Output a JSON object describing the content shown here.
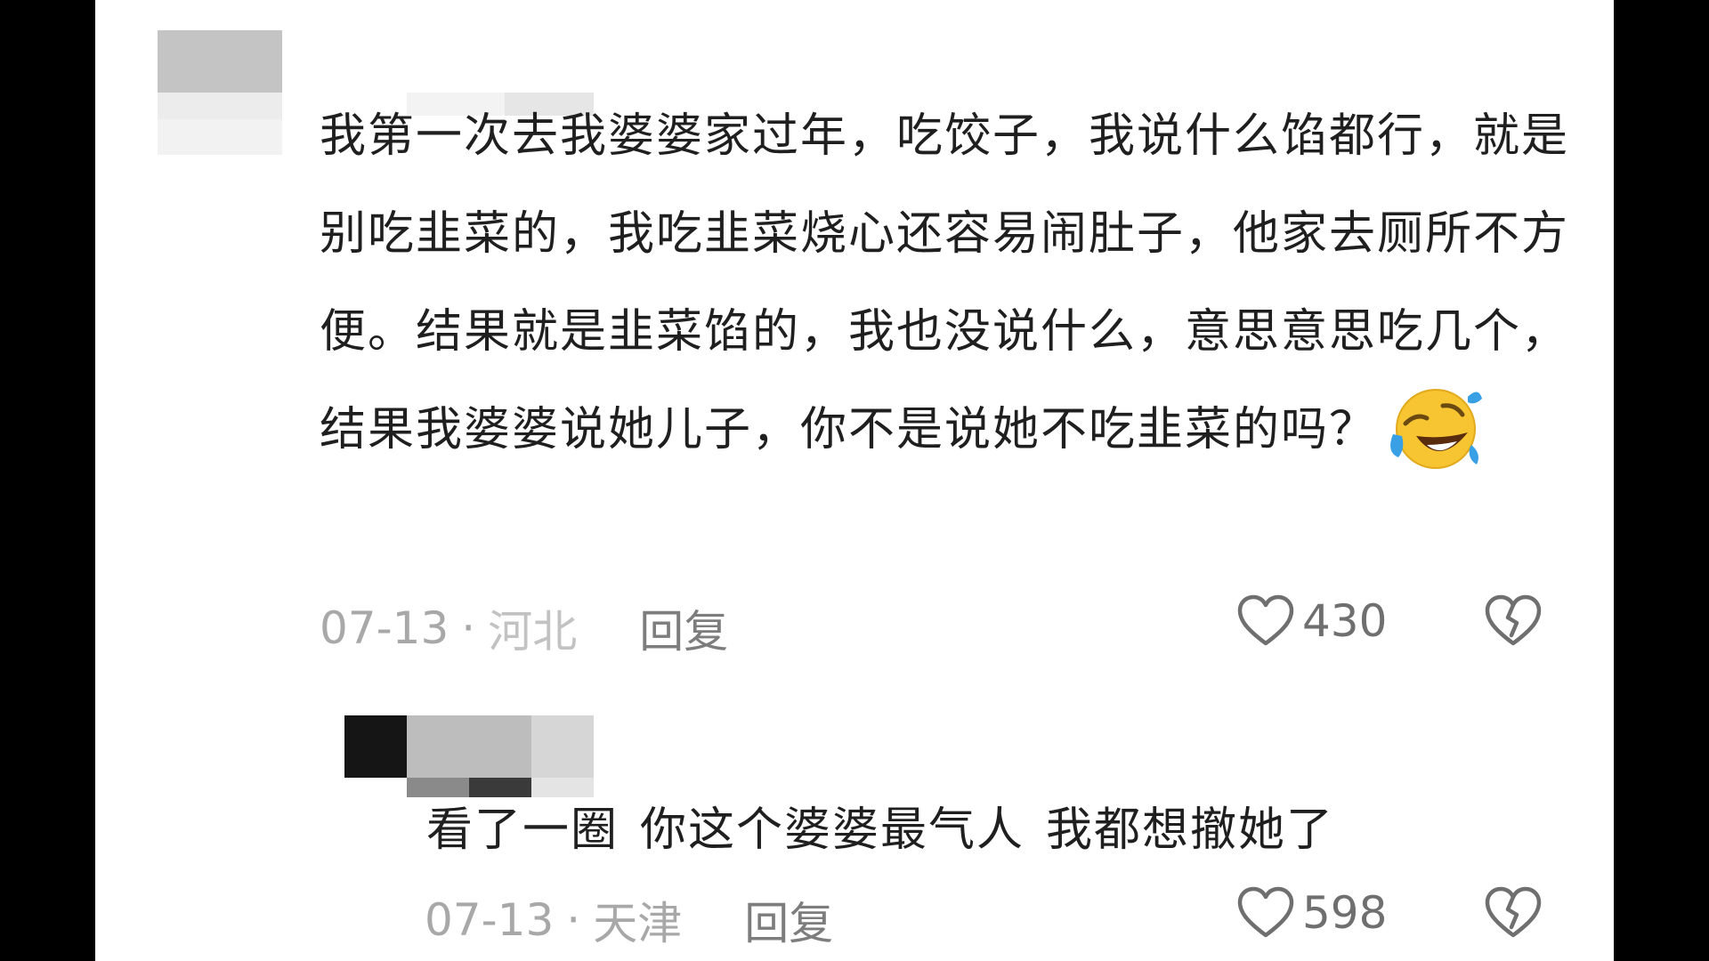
{
  "comments": [
    {
      "text": "我第一次去我婆婆家过年，吃饺子，我说什么馅都行，就是别吃韭菜的，我吃韭菜烧心还容易闹肚子，他家去厕所不方便。结果就是韭菜馅的，我也没说什么，意思意思吃几个，结果我婆婆说她儿子，你不是说她不吃韭菜的吗？",
      "emoji": "rolling-on-floor-laughing-emoji",
      "date": "07-13",
      "separator": "·",
      "location": "河北",
      "reply_label": "回复",
      "likes": "430"
    }
  ],
  "reply": {
    "text_parts": [
      "看了一圈",
      "你这个婆婆最气人",
      "我都想撤她了"
    ],
    "date": "07-13",
    "separator": "·",
    "location": "天津",
    "reply_label": "回复",
    "likes": "598"
  },
  "icons": {
    "like": "heart-outline-icon",
    "dislike": "broken-heart-icon"
  },
  "colors": {
    "background": "#ffffff",
    "letterbox": "#000000",
    "text": "#1f1f1f",
    "meta": "#a8a8a8",
    "emoji_face": "#f7c531",
    "emoji_tears": "#3aa0e6"
  }
}
